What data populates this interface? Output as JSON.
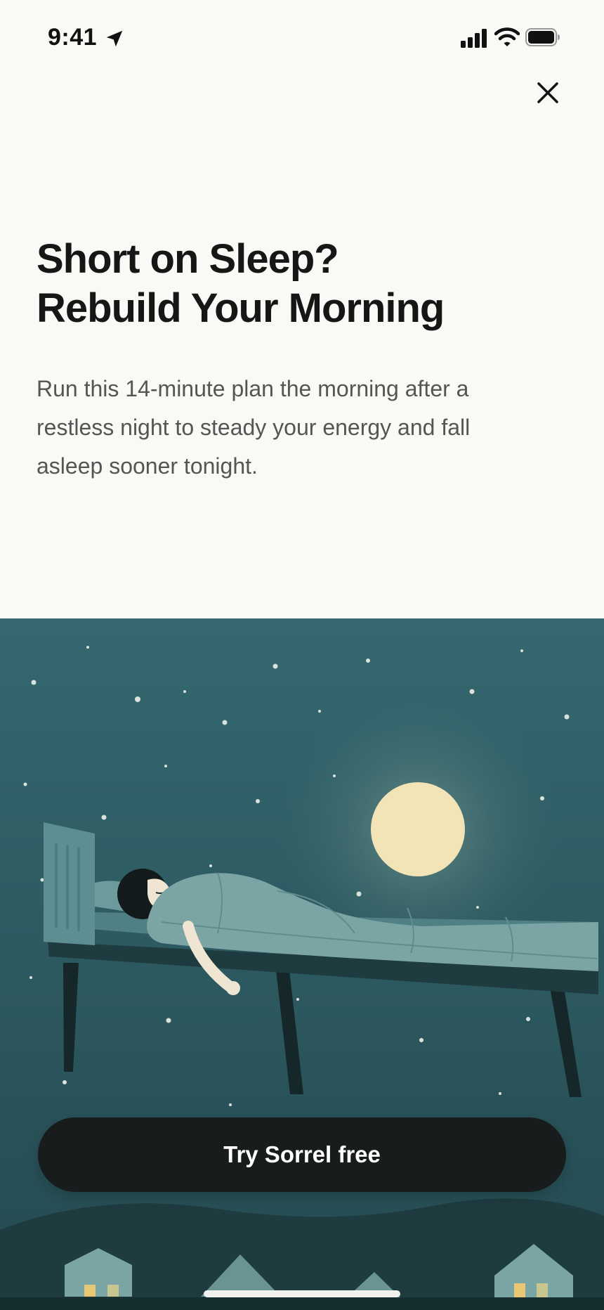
{
  "status_bar": {
    "time": "9:41"
  },
  "headline": {
    "line1": "Short on Sleep?",
    "line2": "Rebuild Your Morning"
  },
  "body": "Run this 14-minute plan the morning after a restless night to steady your energy and fall asleep sooner tonight.",
  "cta": {
    "label": "Try Sorrel free"
  },
  "icons": [
    "location-arrow-icon",
    "cellular-signal-icon",
    "wifi-icon",
    "battery-icon",
    "close-icon"
  ],
  "colors": {
    "background": "#faf9f6",
    "sky": "#2f5e63",
    "moon": "#f3e4b8",
    "button": "#181c1d",
    "button_text": "#ffffff"
  }
}
